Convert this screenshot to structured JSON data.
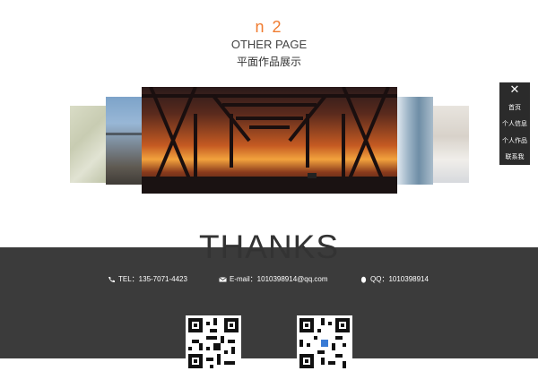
{
  "header": {
    "number": "n 2",
    "title": "OTHER PAGE",
    "subtitle": "平面作品展示"
  },
  "gallery": {
    "items": [
      "grass-photo",
      "building-photo",
      "bridge-photo",
      "window-photo",
      "room-photo"
    ]
  },
  "sidemenu": {
    "close": "✕",
    "items": [
      "首页",
      "个人信息",
      "个人作品",
      "联系我"
    ]
  },
  "footer": {
    "thanks": "THANKS",
    "tel": "TEL：135-7071-4423",
    "email": "E-mail：1010398914@qq.com",
    "qq": "QQ：1010398914"
  },
  "colors": {
    "accent": "#f07b2f",
    "footer_bg": "#3b3b3b",
    "menu_bg": "#2b2b2b"
  }
}
